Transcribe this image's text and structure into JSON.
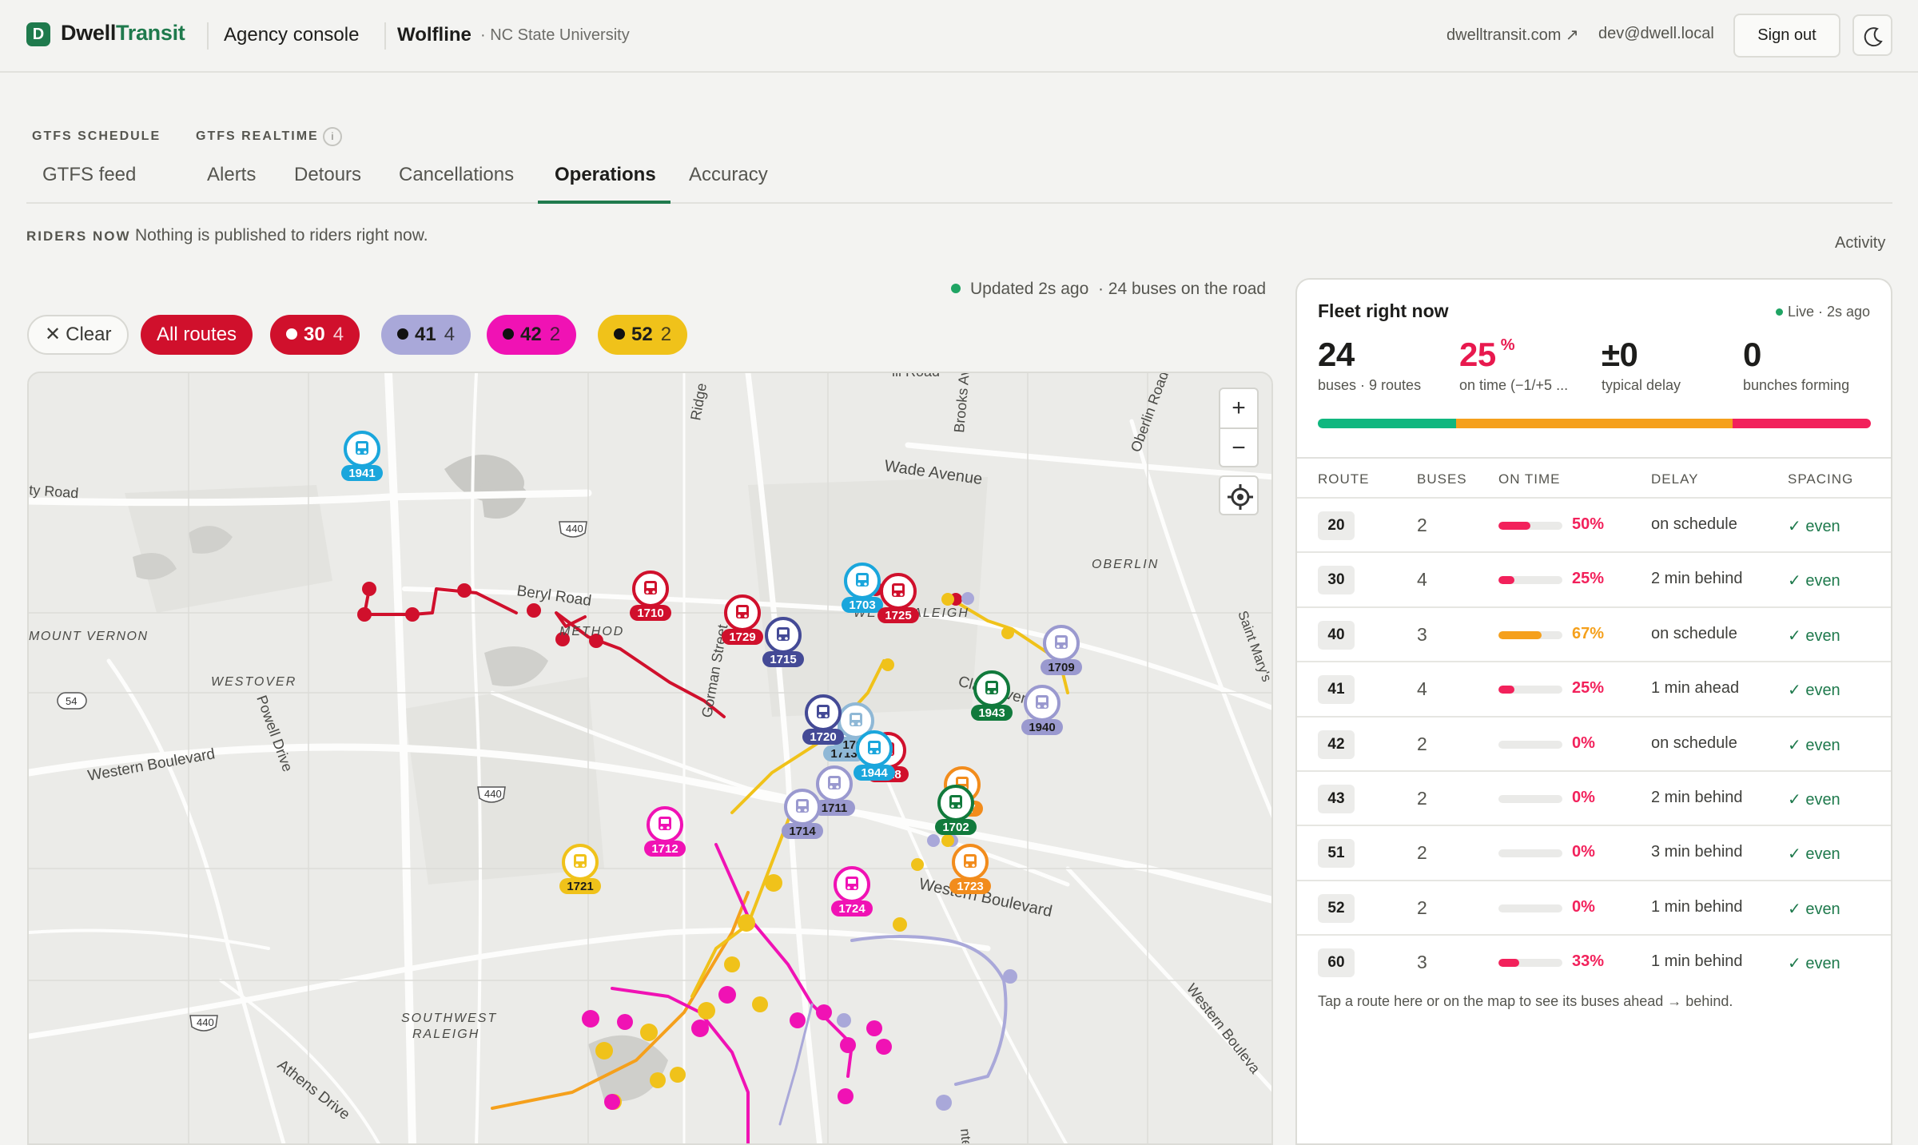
{
  "header": {
    "brand_mark": "D",
    "brand_first": "Dwell",
    "brand_second": "Transit",
    "console": "Agency console",
    "agency": "Wolfline",
    "institution": "· NC State University",
    "site_link": "dwelltransit.com ↗",
    "user": "dev@dwell.local",
    "signout": "Sign out",
    "theme_icon": "moon-icon"
  },
  "nav": {
    "group_schedule": "GTFS SCHEDULE",
    "group_realtime": "GTFS REALTIME",
    "info": "i",
    "tabs": [
      "GTFS feed",
      "Alerts",
      "Detours",
      "Cancellations",
      "Operations",
      "Accuracy"
    ],
    "active_tab": "Operations"
  },
  "riders": {
    "label": "RIDERS NOW",
    "message": "Nothing is published to riders right now.",
    "activity": "Activity"
  },
  "status": {
    "updated": "Updated 2s ago",
    "buses": "· 24 buses on the road"
  },
  "filters": {
    "clear": "Clear",
    "all": "All routes",
    "chips": [
      {
        "route": "30",
        "count": "4",
        "bg": "#d0102c",
        "fg": "#ffffff",
        "dot": "#ffffff"
      },
      {
        "route": "41",
        "count": "4",
        "bg": "#a9a8d9",
        "fg": "#1d1d1b",
        "dot": "#111111"
      },
      {
        "route": "42",
        "count": "2",
        "bg": "#f012b4",
        "fg": "#1d1d1b",
        "dot": "#111111"
      },
      {
        "route": "52",
        "count": "2",
        "bg": "#f0c21a",
        "fg": "#1d1d1b",
        "dot": "#111111"
      }
    ]
  },
  "map": {
    "zoom_in": "+",
    "zoom_out": "−",
    "locate_icon": "locate-icon",
    "labels": {
      "wade": "Wade Avenue",
      "oberlin_rd": "Oberlin Road",
      "oberlin": "OBERLIN",
      "brooks": "Brooks Ave",
      "ridge": "Ridge",
      "hill_road": "ill Road",
      "ty_road": "ty Road",
      "beryl": "Beryl Road",
      "method": "METHOD",
      "mount_vernon": "MOUNT VERNON",
      "westover": "WESTOVER",
      "powell": "Powell Drive",
      "western_w": "Western Boulevard",
      "western_e": "Western Boulevard",
      "western_se": "Western Bouleva",
      "west_raleigh": "WEST RALEIGH",
      "clark": "Clark Avenue",
      "gorman": "Gorman Street",
      "saint_marys": "Saint Mary's",
      "sw_raleigh_1": "SOUTHWEST",
      "sw_raleigh_2": "RALEIGH",
      "athens": "Athens Drive",
      "i440": "440",
      "r54": "54",
      "tenn": "nten"
    },
    "buses": [
      {
        "id": "1941",
        "color": "#1aa6dc"
      },
      {
        "id": "1710",
        "color": "#d0102c"
      },
      {
        "id": "1729",
        "color": "#d0102c"
      },
      {
        "id": "1715",
        "color": "#444a96"
      },
      {
        "id": "1703",
        "color": "#1aa6dc"
      },
      {
        "id": "1725",
        "color": "#d0102c"
      },
      {
        "id": "1709",
        "color": "#9a99cf"
      },
      {
        "id": "1943",
        "color": "#117a3c"
      },
      {
        "id": "1940",
        "color": "#9a99cf"
      },
      {
        "id": "1713",
        "color": "#8fb8d6"
      },
      {
        "id": "1705",
        "color": "#8fb8d6"
      },
      {
        "id": "1720",
        "color": "#444a96"
      },
      {
        "id": "1728",
        "color": "#d0102c"
      },
      {
        "id": "1944",
        "color": "#1aa6dc"
      },
      {
        "id": "1711",
        "color": "#9a99cf"
      },
      {
        "id": "1714",
        "color": "#9a99cf"
      },
      {
        "id": "1712",
        "color": "#f012b4"
      },
      {
        "id": "1717",
        "color": "#f28c1c"
      },
      {
        "id": "1702",
        "color": "#117a3c"
      },
      {
        "id": "1721",
        "color": "#f0c21a"
      },
      {
        "id": "1723",
        "color": "#f28c1c"
      },
      {
        "id": "1724",
        "color": "#f012b4"
      }
    ]
  },
  "fleet": {
    "title": "Fleet right now",
    "live": "Live · 2s ago",
    "kpis": [
      {
        "value": "24",
        "label": "buses · 9 routes"
      },
      {
        "value": "25",
        "unit": "%",
        "label": "on time (−1/+5 ..."
      },
      {
        "value": "±0",
        "label": "typical delay"
      },
      {
        "value": "0",
        "label": "bunches forming"
      }
    ],
    "bar": [
      {
        "share": 0.25,
        "color": "#10b77f"
      },
      {
        "share": 0.5,
        "color": "#f5a01c"
      },
      {
        "share": 0.25,
        "color": "#f2215b"
      }
    ],
    "columns": [
      "ROUTE",
      "BUSES",
      "ON TIME",
      "DELAY",
      "SPACING"
    ],
    "rows": [
      {
        "route": "20",
        "buses": "2",
        "ontime": "50%",
        "ontime_value": 0.5,
        "delay": "on schedule",
        "spacing": "✓ even",
        "color": "#f2215b"
      },
      {
        "route": "30",
        "buses": "4",
        "ontime": "25%",
        "ontime_value": 0.25,
        "delay": "2 min behind",
        "spacing": "✓ even",
        "color": "#f2215b"
      },
      {
        "route": "40",
        "buses": "3",
        "ontime": "67%",
        "ontime_value": 0.67,
        "delay": "on schedule",
        "spacing": "✓ even",
        "color": "#f5a01c"
      },
      {
        "route": "41",
        "buses": "4",
        "ontime": "25%",
        "ontime_value": 0.25,
        "delay": "1 min ahead",
        "spacing": "✓ even",
        "color": "#f2215b"
      },
      {
        "route": "42",
        "buses": "2",
        "ontime": "0%",
        "ontime_value": 0,
        "delay": "on schedule",
        "spacing": "✓ even",
        "color": "#f2215b"
      },
      {
        "route": "43",
        "buses": "2",
        "ontime": "0%",
        "ontime_value": 0,
        "delay": "2 min behind",
        "spacing": "✓ even",
        "color": "#f2215b"
      },
      {
        "route": "51",
        "buses": "2",
        "ontime": "0%",
        "ontime_value": 0,
        "delay": "3 min behind",
        "spacing": "✓ even",
        "color": "#f2215b"
      },
      {
        "route": "52",
        "buses": "2",
        "ontime": "0%",
        "ontime_value": 0,
        "delay": "1 min behind",
        "spacing": "✓ even",
        "color": "#f2215b"
      },
      {
        "route": "60",
        "buses": "3",
        "ontime": "33%",
        "ontime_value": 0.33,
        "delay": "1 min behind",
        "spacing": "✓ even",
        "color": "#f2215b"
      }
    ],
    "footnote": "Tap a route here or on the map to see its buses ahead → behind."
  }
}
